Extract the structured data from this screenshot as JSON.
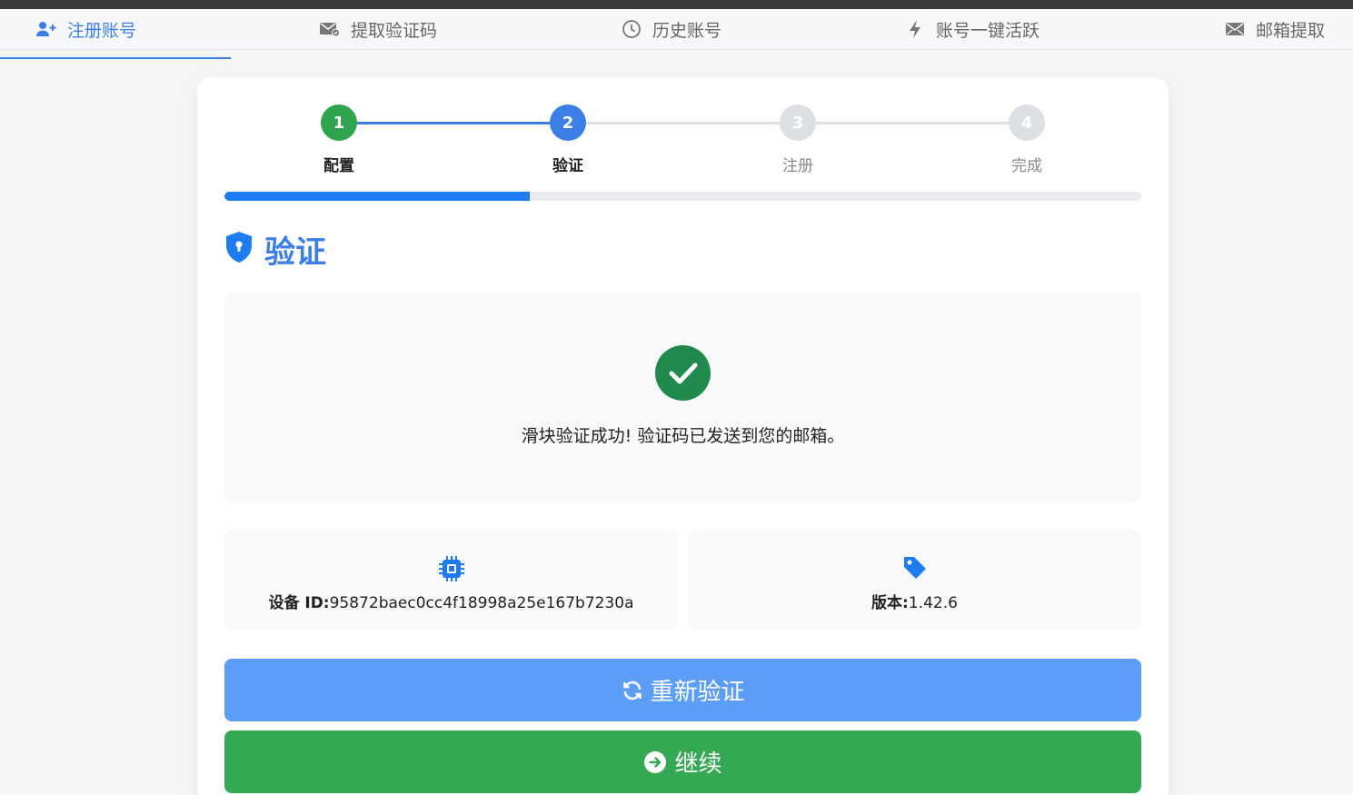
{
  "tabs": [
    {
      "label": "注册账号",
      "icon": "user-plus-icon",
      "active": true
    },
    {
      "label": "提取验证码",
      "icon": "mail-check-icon",
      "active": false
    },
    {
      "label": "历史账号",
      "icon": "clock-icon",
      "active": false
    },
    {
      "label": "账号一键活跃",
      "icon": "bolt-icon",
      "active": false
    },
    {
      "label": "邮箱提取",
      "icon": "envelope-icon",
      "active": false
    }
  ],
  "steps": [
    {
      "number": "1",
      "label": "配置",
      "status": "done"
    },
    {
      "number": "2",
      "label": "验证",
      "status": "current"
    },
    {
      "number": "3",
      "label": "注册",
      "status": "pending"
    },
    {
      "number": "4",
      "label": "完成",
      "status": "pending"
    }
  ],
  "progress": 0.333,
  "section": {
    "title": "验证",
    "icon": "shield-lock-icon"
  },
  "message": {
    "text": "滑块验证成功! 验证码已发送到您的邮箱。",
    "icon": "check-circle-icon"
  },
  "device": {
    "label": "设备 ID:",
    "value": "95872baec0cc4f18998a25e167b7230a",
    "icon": "chip-icon"
  },
  "version": {
    "label": "版本:",
    "value": "1.42.6",
    "icon": "tag-icon"
  },
  "buttons": {
    "reverify": {
      "label": "重新验证",
      "icon": "refresh-icon"
    },
    "continue": {
      "label": "继续",
      "icon": "arrow-right-circle-icon"
    }
  },
  "colors": {
    "accent": "#3b7fe6",
    "done": "#2ea44f",
    "pending": "#dcdfe3",
    "reverify_button": "#5c9ef7",
    "continue_button": "#34a853",
    "progress_fill": "#1f7bf2"
  }
}
